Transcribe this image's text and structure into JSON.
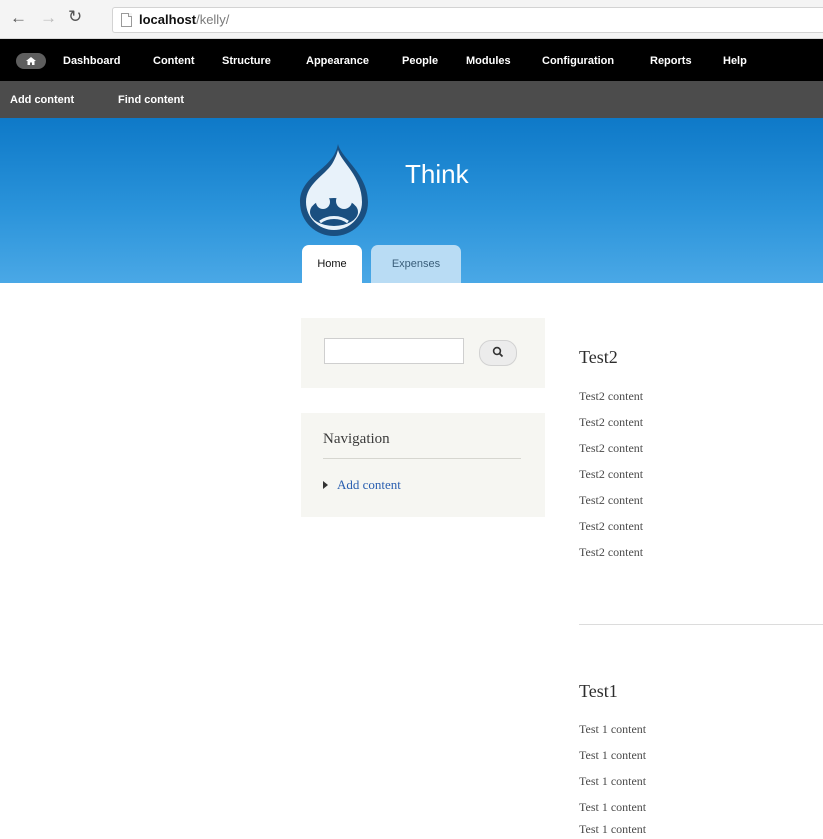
{
  "browser": {
    "url_host": "localhost",
    "url_path": "/kelly/"
  },
  "toolbar": {
    "menu": [
      "Dashboard",
      "Content",
      "Structure",
      "Appearance",
      "People",
      "Modules",
      "Configuration",
      "Reports",
      "Help"
    ]
  },
  "shortcuts": [
    "Add content",
    "Find content"
  ],
  "header": {
    "site_name": "Think",
    "tabs": [
      "Home",
      "Expenses"
    ]
  },
  "sidebar": {
    "search": {
      "value": "",
      "placeholder": ""
    },
    "navigation": {
      "title": "Navigation",
      "items": [
        "Add content"
      ]
    }
  },
  "nodes": [
    {
      "title": "Test2",
      "lines": [
        "Test2 content",
        "Test2 content",
        "Test2 content",
        "Test2 content",
        "Test2 content",
        "Test2 content",
        "Test2 content"
      ]
    },
    {
      "title": "Test1",
      "lines": [
        "Test 1 content",
        "Test 1 content",
        "Test 1 content",
        "Test 1 content",
        "Test 1 content"
      ]
    }
  ],
  "colors": {
    "toolbar": "#000000",
    "shortcuts_bar": "#4c4c4c",
    "header_top": "#0e79c8",
    "header_bottom": "#4aa8e6",
    "link": "#2a5fb0",
    "sidebar_block": "#f6f6f2"
  }
}
